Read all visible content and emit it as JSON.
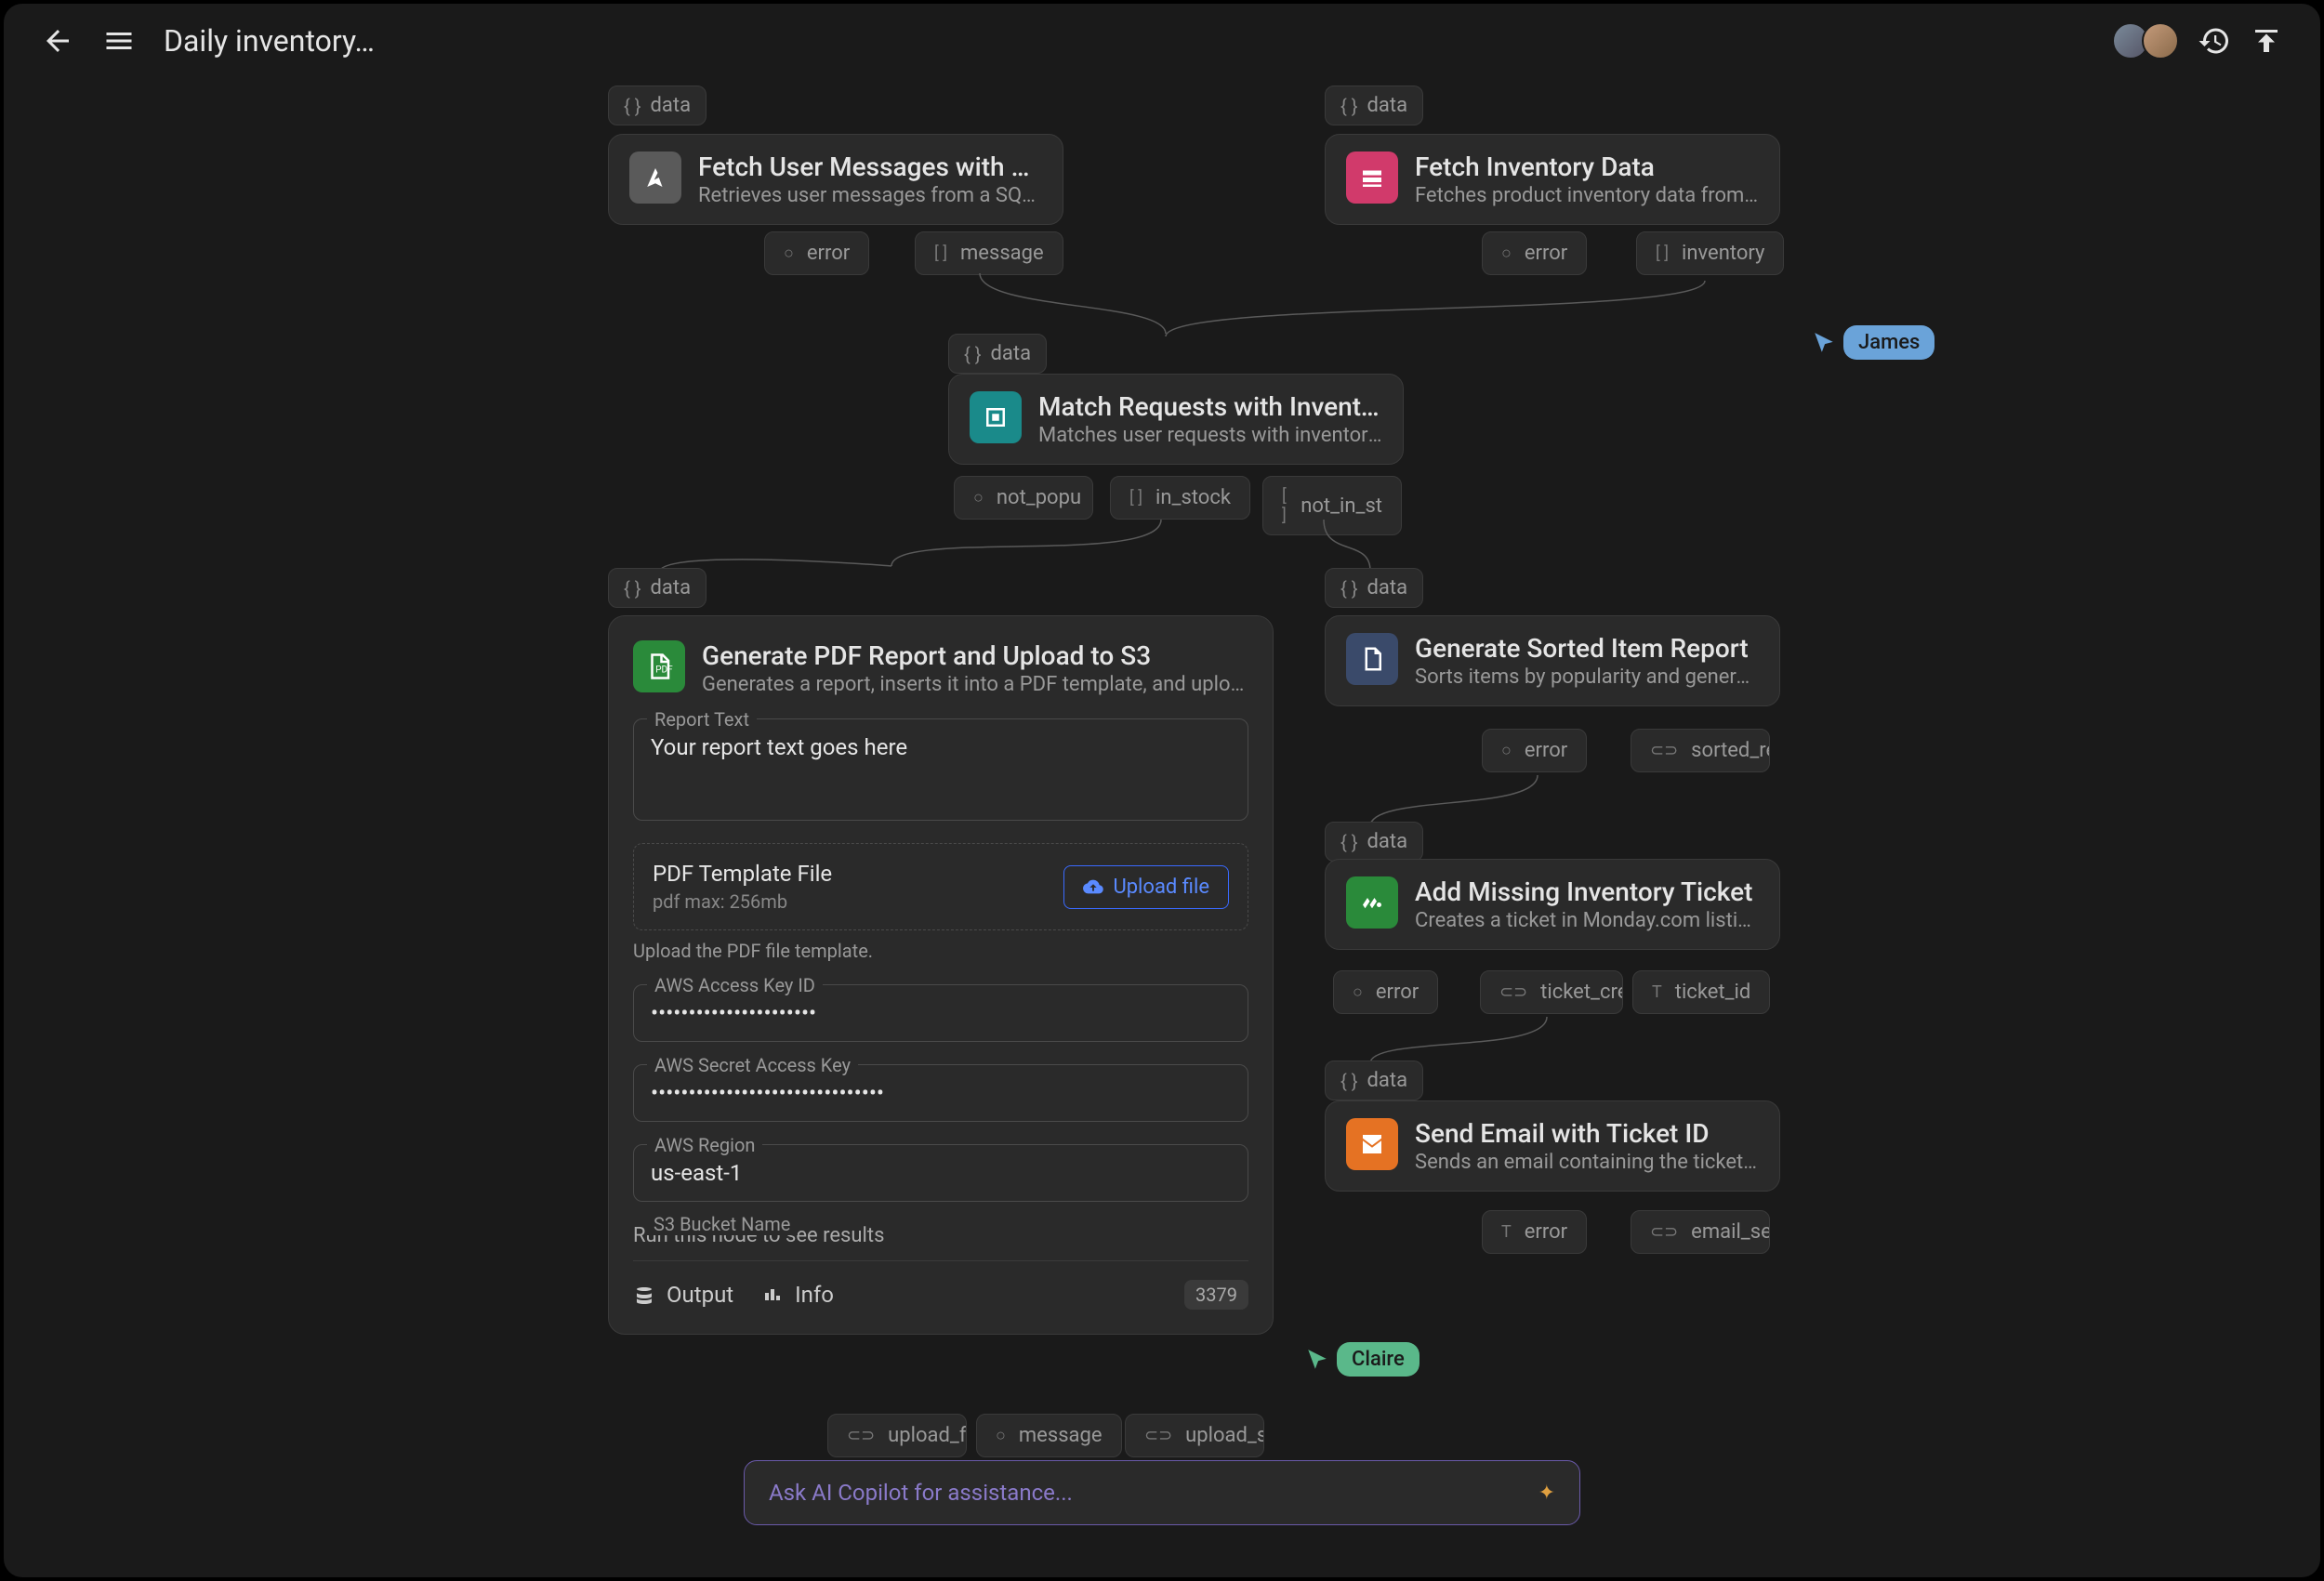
{
  "header": {
    "title": "Daily inventory…"
  },
  "collaborators": [
    {
      "name": "James"
    },
    {
      "name": "Claire"
    }
  ],
  "cursors": {
    "james": "James",
    "claire": "Claire"
  },
  "copilot": {
    "placeholder": "Ask AI Copilot for assistance..."
  },
  "nodes": {
    "fetchUser": {
      "input": {
        "label": "data",
        "icon": "{ }"
      },
      "title": "Fetch User Messages with Cre",
      "sub": "Retrieves user messages from a SQL…",
      "outputs": [
        {
          "icon": "○",
          "label": "error"
        },
        {
          "icon": "[ ]",
          "label": "message"
        }
      ]
    },
    "fetchInv": {
      "input": {
        "label": "data",
        "icon": "{ }"
      },
      "title": "Fetch Inventory Data",
      "sub": "Fetches product inventory data from…",
      "outputs": [
        {
          "icon": "○",
          "label": "error"
        },
        {
          "icon": "[ ]",
          "label": "inventory"
        }
      ]
    },
    "match": {
      "input": {
        "label": "data",
        "icon": "{ }"
      },
      "title": "Match Requests with Inventory",
      "sub": "Matches user requests with inventory a…",
      "outputs": [
        {
          "icon": "○",
          "label": "not_popu"
        },
        {
          "icon": "[ ]",
          "label": "in_stock"
        },
        {
          "icon": "[ ]",
          "label": "not_in_st"
        }
      ]
    },
    "pdf": {
      "input": {
        "label": "data",
        "icon": "{ }"
      },
      "title": "Generate PDF Report and Upload to S3",
      "sub": "Generates a report, inserts it into a PDF template, and uploads it …",
      "fields": {
        "reportText": {
          "label": "Report Text",
          "value": "Your report text goes here"
        },
        "templateTitle": "PDF Template File",
        "templateSub": "pdf max: 256mb",
        "uploadBtn": "Upload file",
        "templateHelp": "Upload the PDF file template.",
        "awsKey": {
          "label": "AWS Access Key ID",
          "value": "••••••••••••••••••••••"
        },
        "awsSecret": {
          "label": "AWS Secret Access Key",
          "value": "•••••••••••••••••••••••••••••••"
        },
        "awsRegion": {
          "label": "AWS Region",
          "value": "us-east-1"
        },
        "bucket": {
          "label": "S3 Bucket Name"
        }
      },
      "footerNote": "Run this node to see results",
      "bar": {
        "output": "Output",
        "info": "Info",
        "count": "3379"
      },
      "outputs": [
        {
          "icon": "⊂⊃",
          "label": "upload_fa"
        },
        {
          "icon": "○",
          "label": "message"
        },
        {
          "icon": "⊂⊃",
          "label": "upload_s"
        }
      ]
    },
    "sorted": {
      "title": "Generate Sorted Item Report",
      "sub": "Sorts items by popularity and generates…",
      "outputs": [
        {
          "icon": "○",
          "label": "error"
        },
        {
          "icon": "⊂⊃",
          "label": "sorted_re"
        }
      ]
    },
    "ticket": {
      "input": {
        "label": "data",
        "icon": "{ }"
      },
      "title": "Add Missing Inventory Ticket",
      "sub": "Creates a ticket in Monday.com listing…",
      "outputs": [
        {
          "icon": "○",
          "label": "error"
        },
        {
          "icon": "⊂⊃",
          "label": "ticket_cre"
        },
        {
          "icon": "T",
          "label": "ticket_id"
        }
      ]
    },
    "email": {
      "input": {
        "label": "data",
        "icon": "{ }"
      },
      "title": "Send Email with Ticket ID",
      "sub": "Sends an email containing the ticket ID.",
      "outputs": [
        {
          "icon": "T",
          "label": "error"
        },
        {
          "icon": "⊂⊃",
          "label": "email_se"
        }
      ]
    }
  }
}
